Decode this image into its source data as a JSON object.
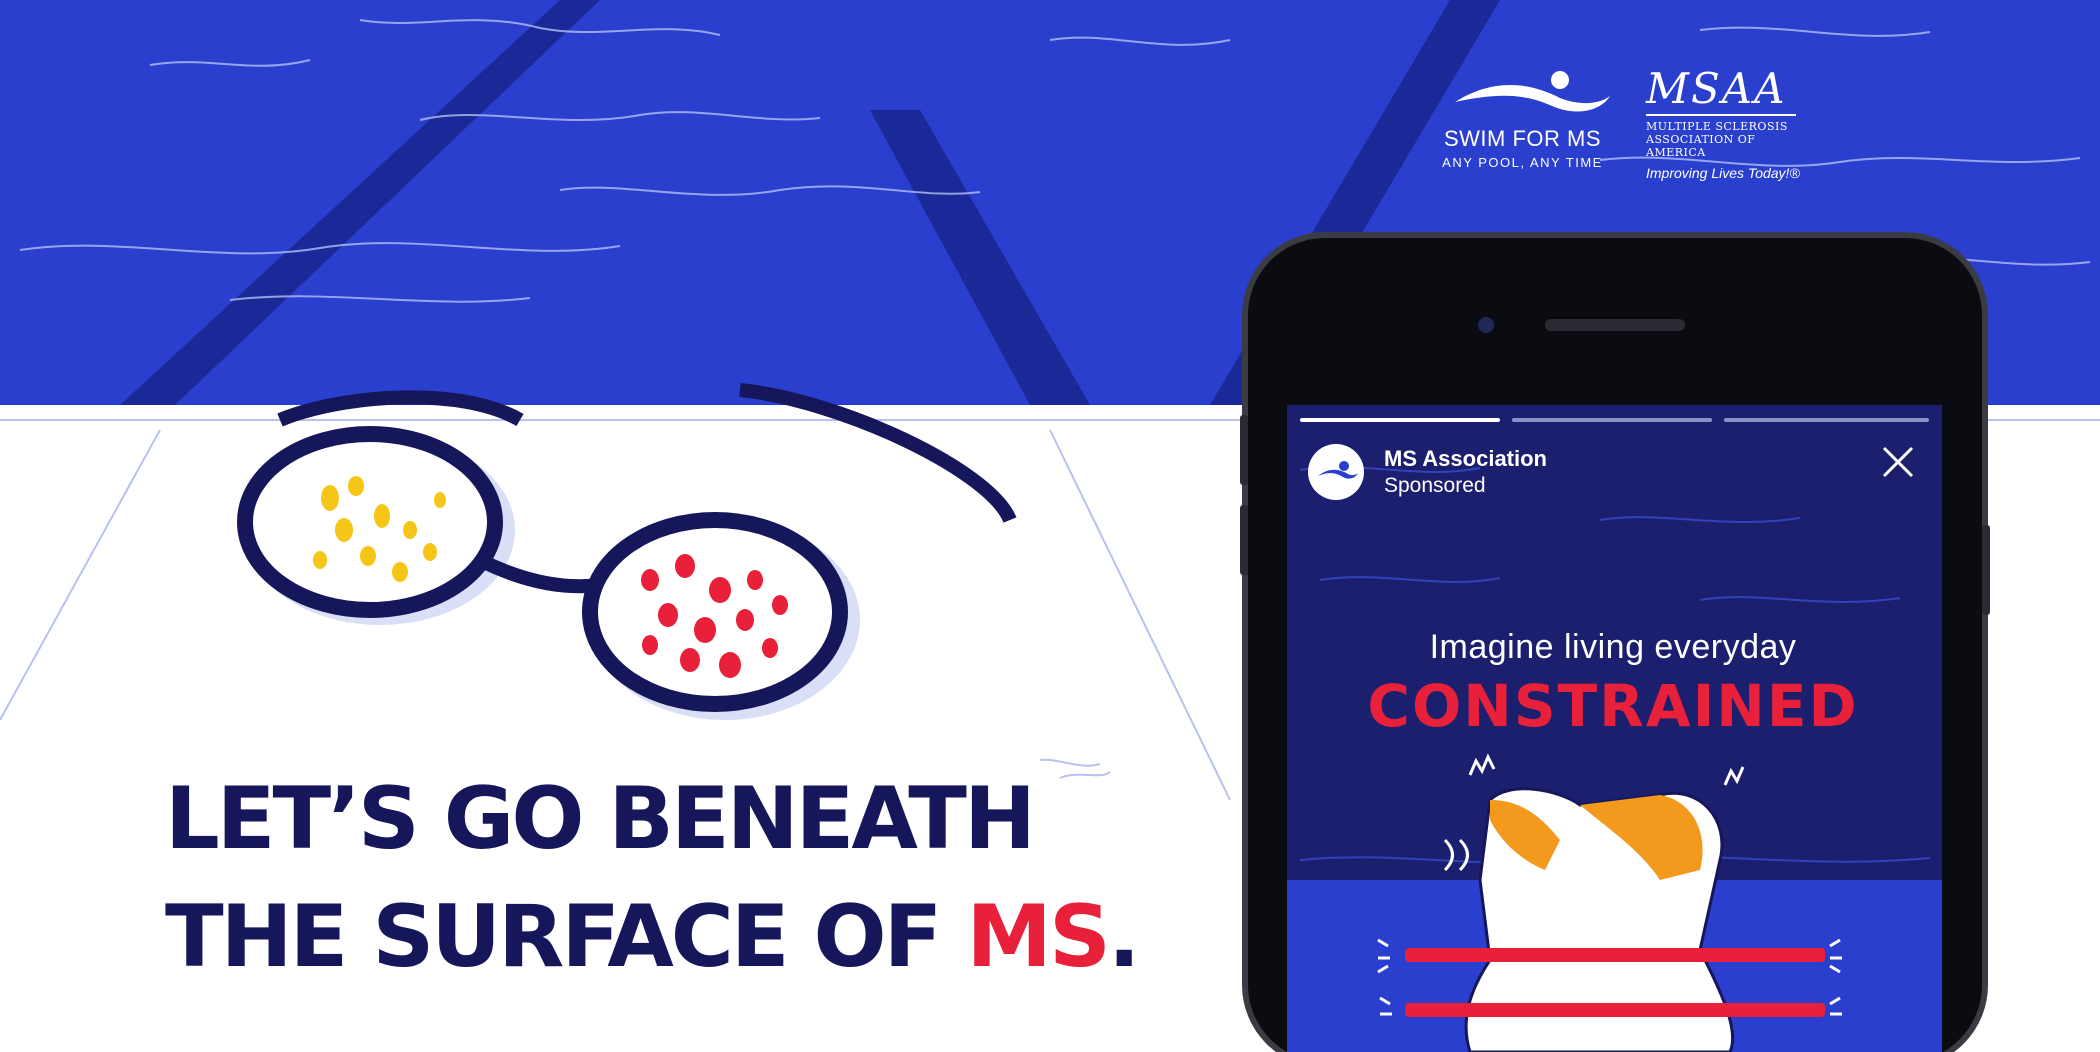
{
  "colors": {
    "pool_blue": "#2b3fcf",
    "navy": "#15175a",
    "accent_red": "#e8203a",
    "white": "#ffffff",
    "lens_yellow": "#f5c518",
    "vest_orange": "#f39a1e"
  },
  "headline": {
    "line1": "LET’S GO BENEATH",
    "line2_prefix": "THE SURFACE OF ",
    "line2_accent": "MS",
    "line2_suffix": "."
  },
  "logos": {
    "swim_name": "SWIM FOR MS",
    "swim_tagline": "ANY POOL, ANY TIME",
    "msaa_wordmark": "MSAA",
    "msaa_full_line1": "Multiple Sclerosis",
    "msaa_full_line2": "Association of America",
    "msaa_tagline": "Improving Lives Today!®"
  },
  "story": {
    "account_name": "MS Association",
    "sponsored_label": "Sponsored",
    "line1": "Imagine living everyday",
    "line2": "CONSTRAINED"
  },
  "icons": {
    "close": "close-icon",
    "avatar": "swimmer-avatar-icon",
    "goggles": "goggles-icon",
    "life_vest": "life-vest-icon"
  }
}
